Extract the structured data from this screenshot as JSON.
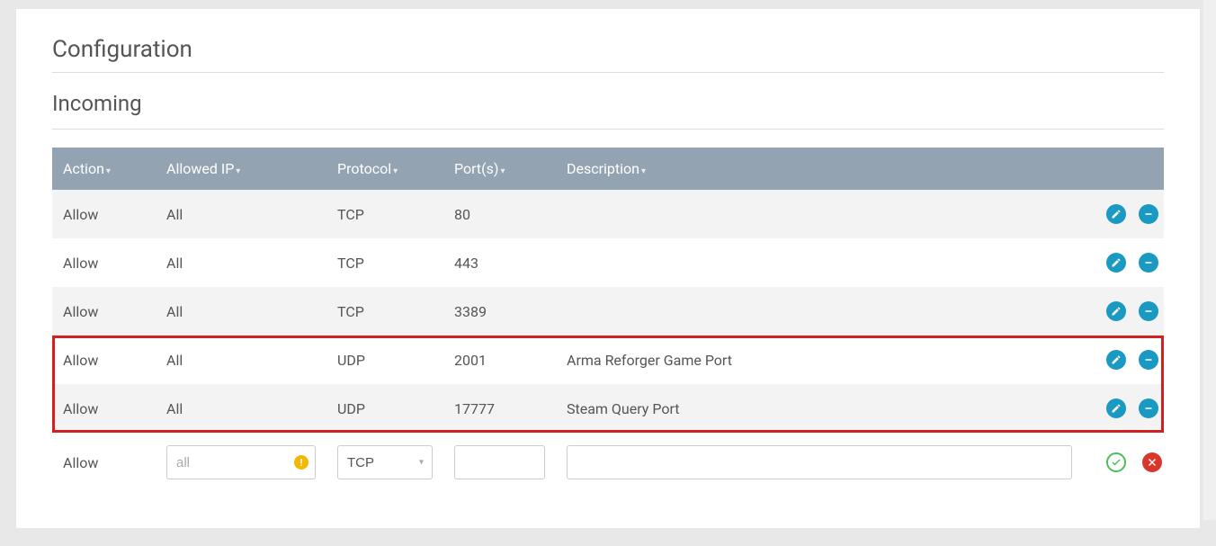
{
  "titles": {
    "configuration": "Configuration",
    "incoming": "Incoming"
  },
  "columns": {
    "action": "Action",
    "allowed_ip": "Allowed IP",
    "protocol": "Protocol",
    "ports": "Port(s)",
    "description": "Description"
  },
  "rows": [
    {
      "action": "Allow",
      "ip": "All",
      "protocol": "TCP",
      "ports": "80",
      "description": ""
    },
    {
      "action": "Allow",
      "ip": "All",
      "protocol": "TCP",
      "ports": "443",
      "description": ""
    },
    {
      "action": "Allow",
      "ip": "All",
      "protocol": "TCP",
      "ports": "3389",
      "description": ""
    },
    {
      "action": "Allow",
      "ip": "All",
      "protocol": "UDP",
      "ports": "2001",
      "description": "Arma Reforger Game Port"
    },
    {
      "action": "Allow",
      "ip": "All",
      "protocol": "UDP",
      "ports": "17777",
      "description": "Steam Query Port"
    }
  ],
  "new_row": {
    "action": "Allow",
    "ip_placeholder": "all",
    "protocol_value": "TCP",
    "port_value": "",
    "description_value": ""
  },
  "highlight_range": {
    "start": 3,
    "end": 4
  }
}
